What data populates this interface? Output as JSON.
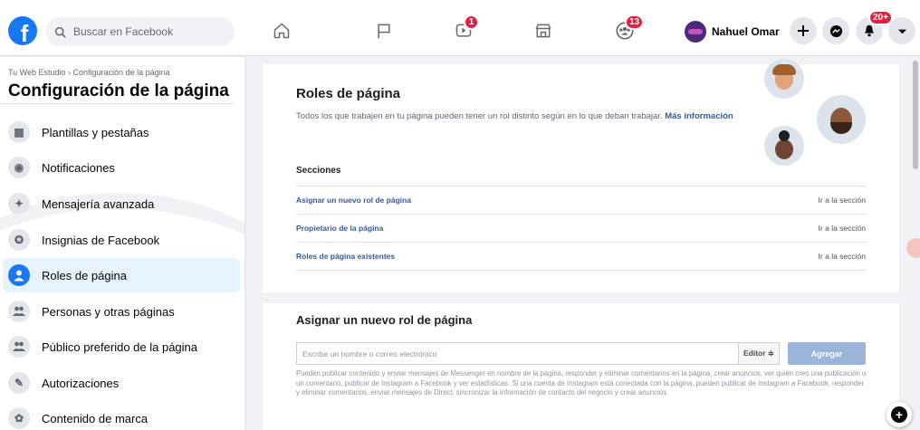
{
  "topbar": {
    "logo_letter": "f",
    "search_placeholder": "Buscar en Facebook",
    "nav": [
      {
        "icon": "home-icon",
        "badge": ""
      },
      {
        "icon": "flag-icon",
        "badge": ""
      },
      {
        "icon": "watch-icon",
        "badge": "1"
      },
      {
        "icon": "marketplace-icon",
        "badge": ""
      },
      {
        "icon": "groups-icon",
        "badge": "13"
      }
    ],
    "profile_name": "Nahuel Omar",
    "actions": [
      {
        "icon": "plus-icon",
        "badge": ""
      },
      {
        "icon": "messenger-icon",
        "badge": ""
      },
      {
        "icon": "bell-icon",
        "badge": "20+"
      },
      {
        "icon": "chevron-down-icon",
        "badge": ""
      }
    ]
  },
  "sidebar": {
    "breadcrumb": "Tu Web Estudio › Configuración de la página",
    "title": "Configuración de la página",
    "items": [
      {
        "label": "Plantillas y pestañas",
        "icon": "grid-icon",
        "glyph": "▦"
      },
      {
        "label": "Notificaciones",
        "icon": "globe-icon",
        "glyph": "◉"
      },
      {
        "label": "Mensajería avanzada",
        "icon": "messenger-icon",
        "glyph": "✦"
      },
      {
        "label": "Insignias de Facebook",
        "icon": "badge-icon",
        "glyph": "✪"
      },
      {
        "label": "Roles de página",
        "icon": "person-icon",
        "glyph": "●",
        "active": true
      },
      {
        "label": "Personas y otras páginas",
        "icon": "people-icon",
        "glyph": "👥"
      },
      {
        "label": "Público preferido de la página",
        "icon": "people-icon",
        "glyph": "👥"
      },
      {
        "label": "Autorizaciones",
        "icon": "wrench-icon",
        "glyph": "✎"
      },
      {
        "label": "Contenido de marca",
        "icon": "handshake-icon",
        "glyph": "✿"
      }
    ]
  },
  "roles": {
    "title": "Roles de página",
    "description": "Todos los que trabajen en tu página pueden tener un rol distinto según en lo que deban trabajar.",
    "more_link": "Más información",
    "sections_label": "Secciones",
    "sections": [
      {
        "label": "Asignar un nuevo rol de página",
        "goto": "Ir a la sección"
      },
      {
        "label": "Propietario de la página",
        "goto": "Ir a la sección"
      },
      {
        "label": "Roles de página existentes",
        "goto": "Ir a la sección"
      }
    ]
  },
  "assign": {
    "title": "Asignar un nuevo rol de página",
    "input_placeholder": "Escribe un nombre o correo electrónico",
    "role_value": "Editor ≑",
    "add_label": "Agregar",
    "help": "Pueden publicar contenido y enviar mensajes de Messenger en nombre de la página, responder y eliminar comentarios en la página, crear anuncios, ver quién creó una publicación o un comentario, publicar de Instagram a Facebook y ver estadísticas. Si una cuenta de Instagram está conectada con la página, pueden publicar de Instagram a Facebook, responder y eliminar comentarios, enviar mensajes de Direct, sincronizar la información de contacto del negocio y crear anuncios."
  },
  "colors": {
    "accent": "#1877f2",
    "link": "#385898",
    "badge": "#e41e3f",
    "active_bg": "#e7f3ff"
  }
}
